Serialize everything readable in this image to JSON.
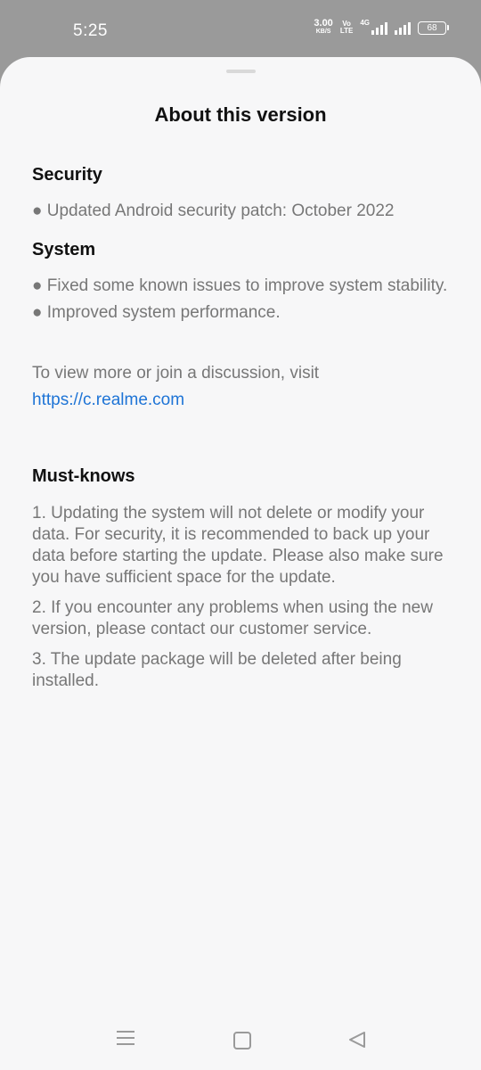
{
  "status_bar": {
    "time": "5:25",
    "speed_value": "3.00",
    "speed_unit": "KB/S",
    "volte_top": "Vo",
    "volte_bottom": "LTE",
    "network": "4G",
    "battery": "68"
  },
  "sheet": {
    "title": "About this version",
    "sections": [
      {
        "heading": "Security",
        "items": [
          "● Updated Android security patch: October 2022"
        ]
      },
      {
        "heading": "System",
        "items": [
          "● Fixed some known issues to improve system stability.",
          "● Improved system performance."
        ]
      }
    ],
    "discussion_text": "To view more or join a discussion, visit",
    "discussion_link": "https://c.realme.com",
    "must_knows": {
      "heading": "Must-knows",
      "items": [
        "1. Updating the system will not delete or modify your data. For security, it is recommended to back up your data before starting the update. Please also make sure you have sufficient space for the update.",
        "2. If you encounter any problems when using the new version, please contact our customer service.",
        "3. The update package will be deleted after being installed."
      ]
    }
  },
  "colors": {
    "accent_link": "#1e74d6",
    "sheet_background": "#f7f7f8",
    "scrim": "#9a9a9a"
  },
  "navbar": {
    "icons": [
      "menu-icon",
      "home-icon",
      "back-icon"
    ]
  }
}
